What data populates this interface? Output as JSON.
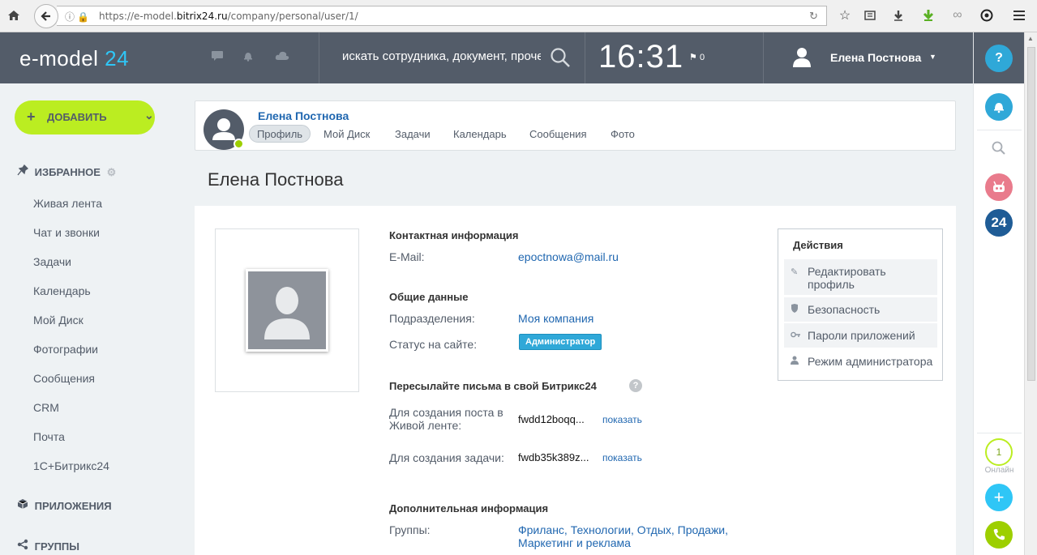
{
  "browser": {
    "url_prefix": "https://e-model.",
    "url_domain": "bitrix24.ru",
    "url_path": "/company/personal/user/1/"
  },
  "header": {
    "logo_text": "e-model",
    "logo_number": "24",
    "search_placeholder": "искать сотрудника, документ, прочее",
    "time": "16:31",
    "flag_count": "0",
    "user_name": "Елена Постнова"
  },
  "right_panel": {
    "help_label": "?",
    "bitrix_label": "24",
    "online_count": "1",
    "online_label": "Онлайн"
  },
  "left_menu": {
    "add_label": "ДОБАВИТЬ",
    "favorites_label": "ИЗБРАННОЕ",
    "items": [
      "Живая лента",
      "Чат и звонки",
      "Задачи",
      "Календарь",
      "Мой Диск",
      "Фотографии",
      "Сообщения",
      "CRM",
      "Почта",
      "1С+Битрикс24"
    ],
    "apps_label": "ПРИЛОЖЕНИЯ",
    "groups_label": "ГРУППЫ"
  },
  "profile_bar": {
    "name": "Елена Постнова",
    "tabs": [
      "Профиль",
      "Мой Диск",
      "Задачи",
      "Календарь",
      "Сообщения",
      "Фото"
    ]
  },
  "page_title": "Елена Постнова",
  "profile": {
    "contact_heading": "Контактная информация",
    "email_label": "E-Mail:",
    "email_value": "epoctnowa@mail.ru",
    "general_heading": "Общие данные",
    "departments_label": "Подразделения:",
    "departments_value": "Моя компания",
    "status_label": "Статус на сайте:",
    "status_value": "Администратор",
    "forward_heading": "Пересылайте письма в свой Битрикс24",
    "help_icon": "?",
    "post_label_1": "Для создания поста в",
    "post_label_2": "Живой ленте:",
    "post_value": "fwdd12boqq...",
    "task_label": "Для создания задачи:",
    "task_value": "fwdb35k389z...",
    "show_label": "показать",
    "extra_heading": "Дополнительная информация",
    "groups_label": "Группы:",
    "groups_line1": "Фриланс, Технологии, Отдых, Продажи,",
    "groups_line2": "Маркетинг и реклама"
  },
  "actions": {
    "title": "Действия",
    "edit_1": "Редактировать",
    "edit_2": "профиль",
    "security": "Безопасность",
    "app_passwords": "Пароли приложений",
    "admin_mode": "Режим администратора"
  },
  "colors": {
    "header_bg": "#535c69",
    "accent_blue": "#2fc6f6",
    "add_button": "#bbed21",
    "link": "#2067b0",
    "online": "#9dcf00"
  }
}
